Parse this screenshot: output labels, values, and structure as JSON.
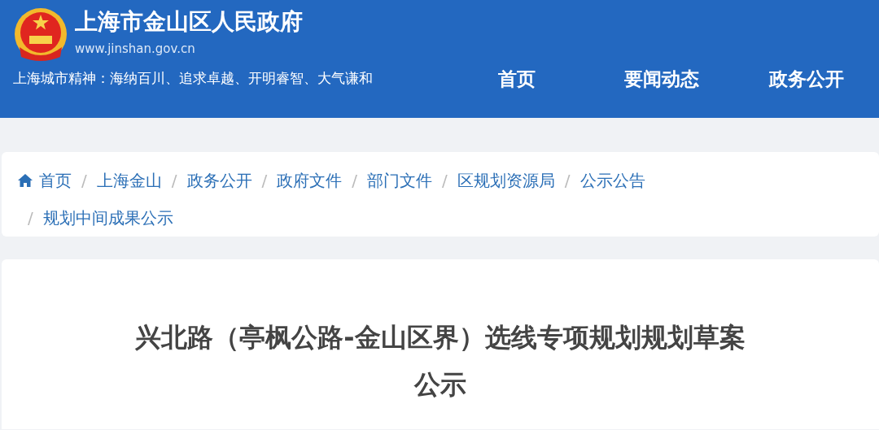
{
  "header": {
    "title": "上海市金山区人民政府",
    "url": "www.jinshan.gov.cn",
    "slogan": "上海城市精神：海纳百川、追求卓越、开明睿智、大气谦和"
  },
  "nav": [
    {
      "label": "首页"
    },
    {
      "label": "要闻动态"
    },
    {
      "label": "政务公开"
    }
  ],
  "breadcrumb": [
    {
      "label": "首页"
    },
    {
      "separator": "/",
      "label": "上海金山"
    },
    {
      "separator": "/",
      "label": "政务公开"
    },
    {
      "separator": "/",
      "label": "政府文件"
    },
    {
      "separator": "/",
      "label": "部门文件"
    },
    {
      "separator": "/",
      "label": "区规划资源局"
    },
    {
      "separator": "/",
      "label": "公示公告"
    },
    {
      "separator": "/",
      "label": "规划中间成果公示"
    }
  ],
  "article": {
    "title": "兴北路（亭枫公路-金山区界）选线专项规划规划草案公示"
  }
}
